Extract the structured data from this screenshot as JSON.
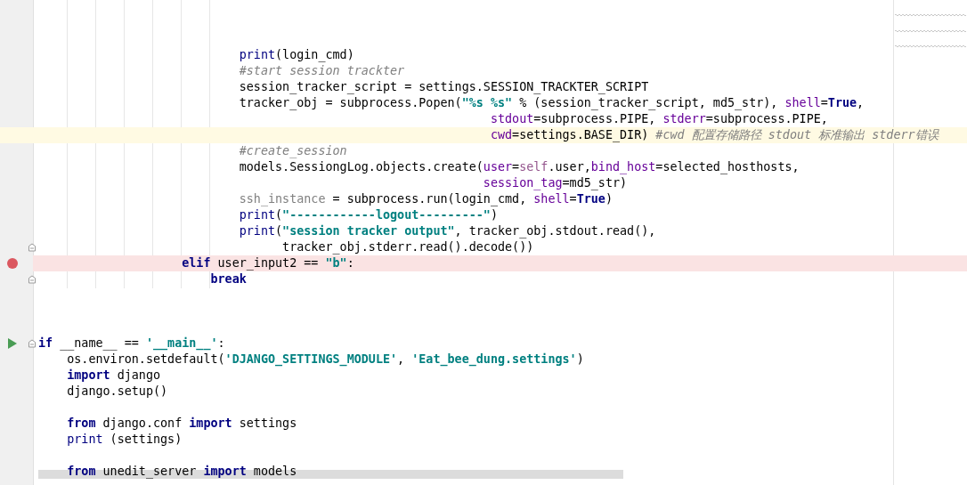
{
  "editor": {
    "lines": [
      {
        "kind": "code",
        "tokens": [
          {
            "kind": "builtin",
            "text": "                            print"
          },
          {
            "kind": "plain",
            "text": "(login_cmd)"
          }
        ]
      },
      {
        "kind": "code",
        "tokens": [
          {
            "kind": "comment",
            "text": "                            #start session trackter"
          }
        ]
      },
      {
        "kind": "code",
        "tokens": [
          {
            "kind": "plain",
            "text": "                            session_tracker_script = settings.SESSION_TRACKTER_SCRIPT"
          }
        ]
      },
      {
        "kind": "code",
        "tokens": [
          {
            "kind": "plain",
            "text": "                            tracker_obj = subprocess.Popen("
          },
          {
            "kind": "string",
            "text": "\"%s %s\""
          },
          {
            "kind": "plain",
            "text": " % (session_tracker_script, md5_str), "
          },
          {
            "kind": "param",
            "text": "shell"
          },
          {
            "kind": "plain",
            "text": "="
          },
          {
            "kind": "keyword",
            "text": "True"
          },
          {
            "kind": "plain",
            "text": ","
          }
        ]
      },
      {
        "kind": "code",
        "tokens": [
          {
            "kind": "param",
            "text": "                                                               stdout"
          },
          {
            "kind": "plain",
            "text": "=subprocess.PIPE, "
          },
          {
            "kind": "param",
            "text": "stderr"
          },
          {
            "kind": "plain",
            "text": "=subprocess.PIPE,"
          }
        ]
      },
      {
        "kind": "code",
        "current": true,
        "tokens": [
          {
            "kind": "param",
            "text": "                                                               cwd"
          },
          {
            "kind": "plain",
            "text": "=settings.BASE_DIR) "
          },
          {
            "kind": "comment",
            "text": "#cwd 配置存储路径 stdout 标准输出 stderr错误"
          }
        ]
      },
      {
        "kind": "code",
        "tokens": [
          {
            "kind": "comment",
            "text": "                            #create_session"
          }
        ]
      },
      {
        "kind": "code",
        "tokens": [
          {
            "kind": "plain",
            "text": "                            models.SessiongLog.objects.create("
          },
          {
            "kind": "param",
            "text": "user"
          },
          {
            "kind": "plain",
            "text": "="
          },
          {
            "kind": "self",
            "text": "self"
          },
          {
            "kind": "plain",
            "text": ".user,"
          },
          {
            "kind": "param",
            "text": "bind_host"
          },
          {
            "kind": "plain",
            "text": "=selected_hosthosts,"
          }
        ]
      },
      {
        "kind": "code",
        "tokens": [
          {
            "kind": "param",
            "text": "                                                              session_tag"
          },
          {
            "kind": "plain",
            "text": "=md5_str)"
          }
        ]
      },
      {
        "kind": "code",
        "tokens": [
          {
            "kind": "unused",
            "text": "                            ssh_instance"
          },
          {
            "kind": "plain",
            "text": " = subprocess.run(login_cmd, "
          },
          {
            "kind": "param",
            "text": "shell"
          },
          {
            "kind": "plain",
            "text": "="
          },
          {
            "kind": "keyword",
            "text": "True"
          },
          {
            "kind": "plain",
            "text": ")"
          }
        ]
      },
      {
        "kind": "code",
        "tokens": [
          {
            "kind": "builtin",
            "text": "                            print"
          },
          {
            "kind": "plain",
            "text": "("
          },
          {
            "kind": "string",
            "text": "\"------------logout---------\""
          },
          {
            "kind": "plain",
            "text": ")"
          }
        ]
      },
      {
        "kind": "code",
        "tokens": [
          {
            "kind": "builtin",
            "text": "                            print"
          },
          {
            "kind": "plain",
            "text": "("
          },
          {
            "kind": "string",
            "text": "\"session tracker output\""
          },
          {
            "kind": "plain",
            "text": ", tracker_obj.stdout.read(),"
          }
        ]
      },
      {
        "kind": "code",
        "fold": true,
        "tokens": [
          {
            "kind": "plain",
            "text": "                                  tracker_obj.stderr.read().decode())"
          }
        ]
      },
      {
        "kind": "code",
        "breakpoint": true,
        "tokens": [
          {
            "kind": "keyword",
            "text": "                    elif"
          },
          {
            "kind": "plain",
            "text": " user_input2 == "
          },
          {
            "kind": "string",
            "text": "\"b\""
          },
          {
            "kind": "plain",
            "text": ":"
          }
        ]
      },
      {
        "kind": "code",
        "fold": true,
        "tokens": [
          {
            "kind": "keyword",
            "text": "                        break"
          }
        ]
      },
      {
        "kind": "blank"
      },
      {
        "kind": "blank"
      },
      {
        "kind": "blank"
      },
      {
        "kind": "code",
        "run": true,
        "fold": true,
        "tokens": [
          {
            "kind": "keyword",
            "text": "if"
          },
          {
            "kind": "plain",
            "text": " __name__ == "
          },
          {
            "kind": "string",
            "text": "'__main__'"
          },
          {
            "kind": "plain",
            "text": ":"
          }
        ]
      },
      {
        "kind": "code",
        "tokens": [
          {
            "kind": "plain",
            "text": "    os.environ.setdefault("
          },
          {
            "kind": "string",
            "text": "'DJANGO_SETTINGS_MODULE'"
          },
          {
            "kind": "plain",
            "text": ", "
          },
          {
            "kind": "string",
            "text": "'Eat_bee_dung.settings'"
          },
          {
            "kind": "plain",
            "text": ")"
          }
        ]
      },
      {
        "kind": "code",
        "tokens": [
          {
            "kind": "keyword",
            "text": "    import"
          },
          {
            "kind": "plain",
            "text": " django"
          }
        ]
      },
      {
        "kind": "code",
        "tokens": [
          {
            "kind": "plain",
            "text": "    django.setup()"
          }
        ]
      },
      {
        "kind": "blank"
      },
      {
        "kind": "code",
        "tokens": [
          {
            "kind": "keyword",
            "text": "    from"
          },
          {
            "kind": "plain",
            "text": " django.conf "
          },
          {
            "kind": "keyword",
            "text": "import"
          },
          {
            "kind": "plain",
            "text": " settings"
          }
        ]
      },
      {
        "kind": "code",
        "tokens": [
          {
            "kind": "builtin",
            "text": "    print"
          },
          {
            "kind": "plain",
            "text": " (settings)"
          }
        ]
      },
      {
        "kind": "blank"
      },
      {
        "kind": "code",
        "tokens": [
          {
            "kind": "keyword",
            "text": "    from"
          },
          {
            "kind": "plain",
            "text": " unedit_server "
          },
          {
            "kind": "keyword",
            "text": "import"
          },
          {
            "kind": "plain",
            "text": " models"
          }
        ]
      }
    ]
  }
}
